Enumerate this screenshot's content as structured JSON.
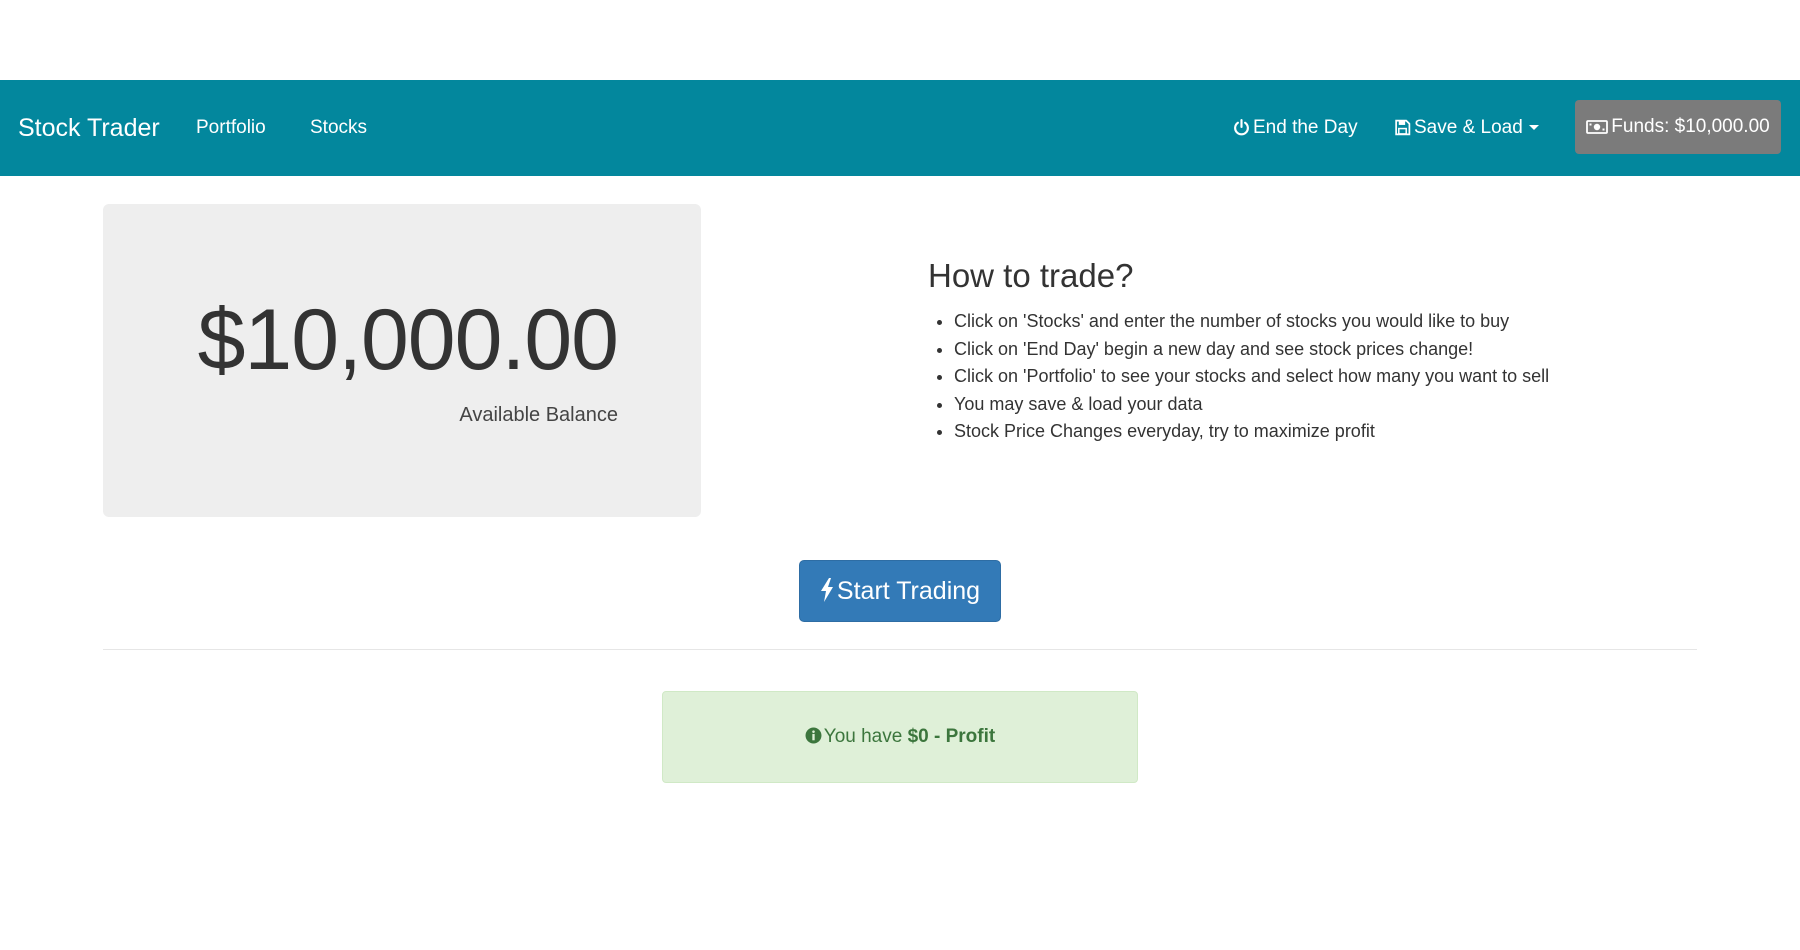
{
  "navbar": {
    "brand": "Stock Trader",
    "links": [
      {
        "label": "Portfolio"
      },
      {
        "label": "Stocks"
      }
    ],
    "end_day": {
      "label": "End the Day",
      "icon": "power-icon"
    },
    "save_load": {
      "label": "Save & Load",
      "icon": "floppy-disk-icon"
    },
    "funds": {
      "label": "Funds: $10,000.00",
      "icon": "money-icon"
    }
  },
  "balance": {
    "amount": "$10,000.00",
    "label": "Available Balance"
  },
  "howto": {
    "title": "How to trade?",
    "items": [
      "Click on 'Stocks' and enter the number of stocks you would like to buy",
      "Click on 'End Day' begin a new day and see stock prices change!",
      "Click on 'Portfolio' to see your stocks and select how many you want to sell",
      "You may save & load your data",
      "Stock Price Changes everyday, try to maximize profit"
    ]
  },
  "start_button": {
    "label": "Start Trading",
    "icon": "bolt-icon"
  },
  "profit": {
    "prefix": "You have ",
    "value": "$0 - Profit",
    "icon": "info-circle-icon"
  },
  "colors": {
    "navbar": "#03879d",
    "funds_badge": "#7b7b7b",
    "primary_button": "#337ab7",
    "success_alert_bg": "#dff0d8",
    "success_alert_text": "#3c763d"
  }
}
